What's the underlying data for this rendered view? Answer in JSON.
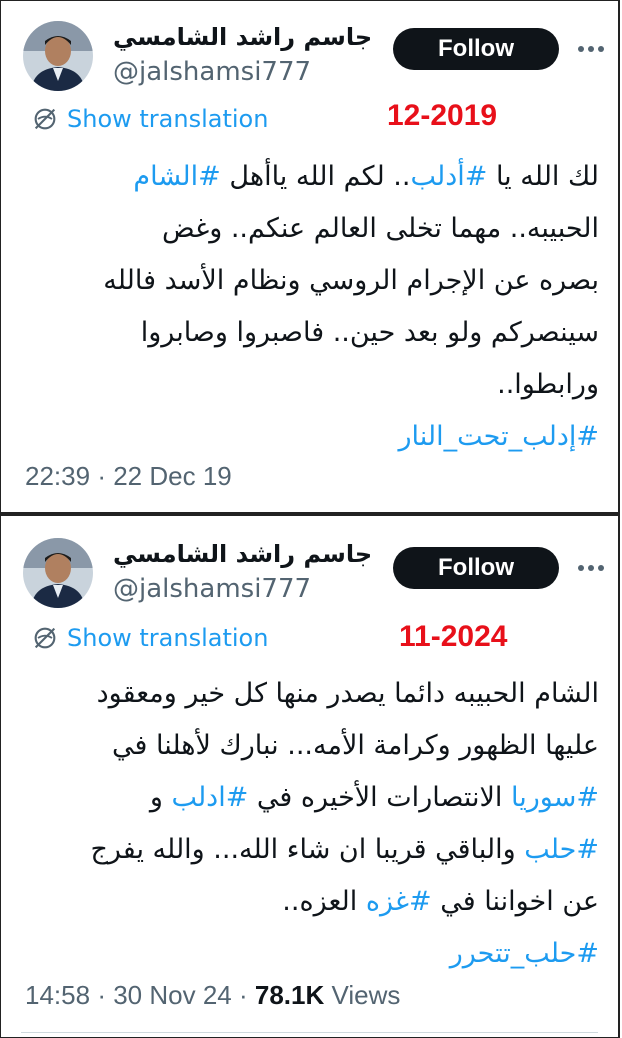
{
  "tweets": [
    {
      "author_name": "جاسم راشد الشامسي",
      "handle": "@jalshamsi777",
      "follow_label": "Follow",
      "show_translation": "Show translation",
      "stamp": "12-2019",
      "lines": [
        [
          "لك الله يا ",
          {
            "tag": "#أدلب"
          },
          ".. لكم الله ياأهل ",
          {
            "tag": "#الشام"
          }
        ],
        [
          "الحبيبه.. مهما تخلى العالم عنكم.. وغض"
        ],
        [
          "بصره عن الإجرام الروسي ونظام الأسد فالله"
        ],
        [
          "سينصركم ولو بعد حين.. فاصبروا وصابروا"
        ],
        [
          "ورابطوا.."
        ],
        [
          {
            "tag": "#إدلب_تحت_النار"
          }
        ]
      ],
      "time": "22:39",
      "date": "22 Dec 19"
    },
    {
      "author_name": "جاسم راشد الشامسي",
      "handle": "@jalshamsi777",
      "follow_label": "Follow",
      "show_translation": "Show translation",
      "stamp": "11-2024",
      "lines": [
        [
          "الشام الحبيبه دائما يصدر منها كل خير ومعقود"
        ],
        [
          "عليها الظهور وكرامة الأمه... نبارك لأهلنا في"
        ],
        [
          {
            "tag": "#سوريا"
          },
          " الانتصارات الأخيره في ",
          {
            "tag": "#ادلب"
          },
          " و"
        ],
        [
          {
            "tag": "#حلب"
          },
          " والباقي قريبا ان شاء الله... والله يفرج"
        ],
        [
          "عن اخواننا في ",
          {
            "tag": "#غزه"
          },
          " العزه.."
        ],
        [
          {
            "tag": "#حلب_تتحرر"
          }
        ]
      ],
      "time": "14:58",
      "date": "30 Nov 24",
      "views_count": "78.1K",
      "views_label": "Views"
    }
  ],
  "colors": {
    "link": "#1d9bf0",
    "stamp": "#e8101a",
    "button": "#0f1419",
    "muted": "#536471"
  },
  "icons": [
    "avatar",
    "translate-icon",
    "more-icon"
  ]
}
